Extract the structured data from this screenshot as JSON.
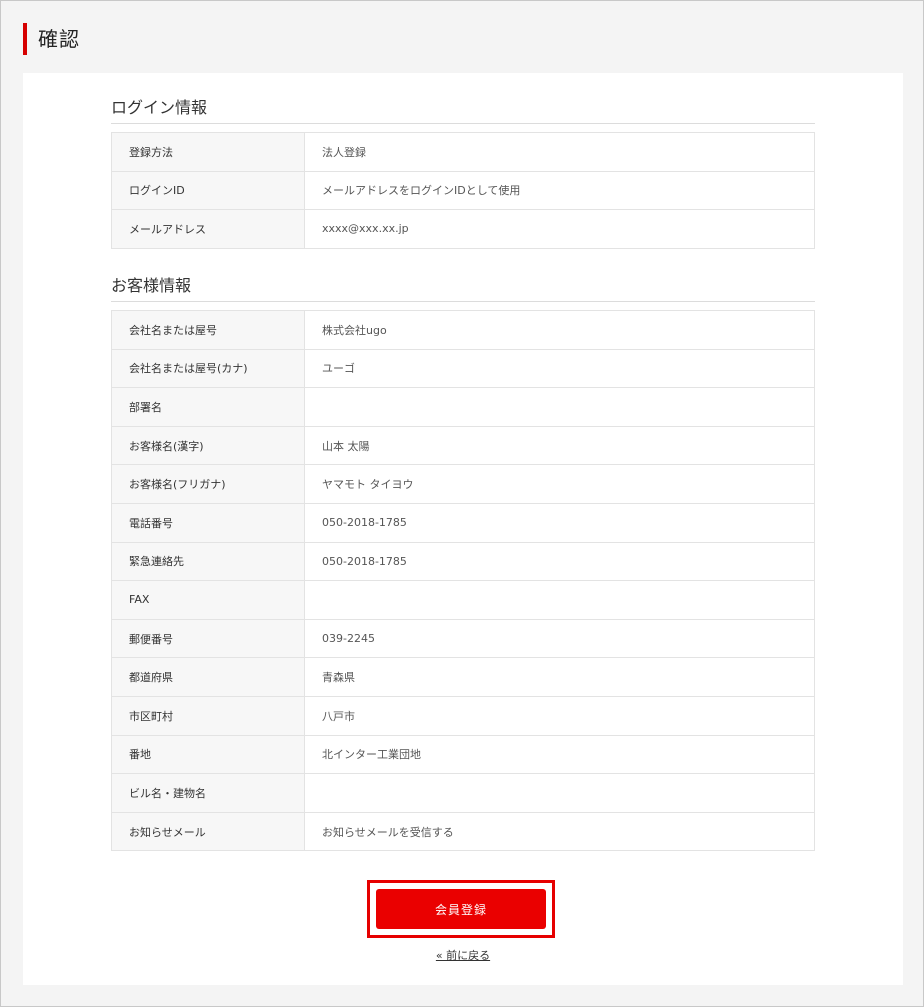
{
  "page": {
    "title": "確認"
  },
  "login_section": {
    "heading": "ログイン情報",
    "rows": [
      {
        "label": "登録方法",
        "value": "法人登録"
      },
      {
        "label": "ログインID",
        "value": "メールアドレスをログインIDとして使用"
      },
      {
        "label": "メールアドレス",
        "value": "xxxx@xxx.xx.jp"
      }
    ]
  },
  "customer_section": {
    "heading": "お客様情報",
    "rows": [
      {
        "label": "会社名または屋号",
        "value": "株式会社ugo"
      },
      {
        "label": "会社名または屋号(カナ)",
        "value": "ユーゴ"
      },
      {
        "label": "部署名",
        "value": ""
      },
      {
        "label": "お客様名(漢字)",
        "value": "山本 太陽"
      },
      {
        "label": "お客様名(フリガナ)",
        "value": "ヤマモト タイヨウ"
      },
      {
        "label": "電話番号",
        "value": "050-2018-1785"
      },
      {
        "label": "緊急連絡先",
        "value": "050-2018-1785"
      },
      {
        "label": "FAX",
        "value": ""
      },
      {
        "label": "郵便番号",
        "value": "039-2245"
      },
      {
        "label": "都道府県",
        "value": "青森県"
      },
      {
        "label": "市区町村",
        "value": "八戸市"
      },
      {
        "label": "番地",
        "value": "北インター工業団地"
      },
      {
        "label": "ビル名・建物名",
        "value": ""
      },
      {
        "label": "お知らせメール",
        "value": "お知らせメールを受信する"
      }
    ]
  },
  "actions": {
    "submit_label": "会員登録",
    "back_label": "« 前に戻る"
  },
  "colors": {
    "accent": "#e60000",
    "label_bg": "#f7f7f7",
    "border": "#e3e3e3"
  }
}
